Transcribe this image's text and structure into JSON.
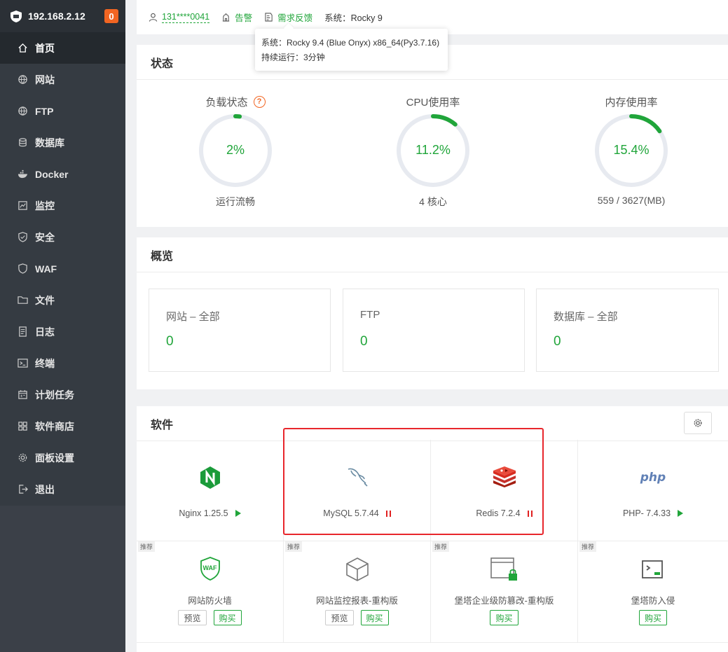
{
  "sidebar": {
    "ip": "192.168.2.12",
    "badge": "0",
    "items": [
      {
        "label": "首页",
        "icon": "home-icon"
      },
      {
        "label": "网站",
        "icon": "globe-icon"
      },
      {
        "label": "FTP",
        "icon": "globe-icon"
      },
      {
        "label": "数据库",
        "icon": "database-icon"
      },
      {
        "label": "Docker",
        "icon": "docker-icon"
      },
      {
        "label": "监控",
        "icon": "monitor-icon"
      },
      {
        "label": "安全",
        "icon": "shield-icon"
      },
      {
        "label": "WAF",
        "icon": "waf-icon"
      },
      {
        "label": "文件",
        "icon": "folder-icon"
      },
      {
        "label": "日志",
        "icon": "log-icon"
      },
      {
        "label": "终端",
        "icon": "terminal-icon"
      },
      {
        "label": "计划任务",
        "icon": "calendar-icon"
      },
      {
        "label": "软件商店",
        "icon": "store-icon"
      },
      {
        "label": "面板设置",
        "icon": "gear-icon"
      },
      {
        "label": "退出",
        "icon": "logout-icon"
      }
    ]
  },
  "topbar": {
    "user": "131****0041",
    "alert": "告警",
    "feedback": "需求反馈",
    "system": "系统：Rocky 9"
  },
  "tooltip": {
    "line1": "系统：Rocky 9.4 (Blue Onyx) x86_64(Py3.7.16)",
    "line2": "持续运行：3分钟"
  },
  "status": {
    "title": "状态",
    "gauges": [
      {
        "label": "负载状态",
        "value": "2%",
        "percent": 2,
        "sub": "运行流畅"
      },
      {
        "label": "CPU使用率",
        "value": "11.2%",
        "percent": 11.2,
        "sub": "4 核心"
      },
      {
        "label": "内存使用率",
        "value": "15.4%",
        "percent": 15.4,
        "sub": "559 / 3627(MB)"
      }
    ],
    "help_icon": "?"
  },
  "overview": {
    "title": "概览",
    "cards": [
      {
        "title": "网站 – 全部",
        "value": "0"
      },
      {
        "title": "FTP",
        "value": "0"
      },
      {
        "title": "数据库 – 全部",
        "value": "0"
      }
    ]
  },
  "software": {
    "title": "软件",
    "installed": [
      {
        "name": "Nginx 1.25.5",
        "state": "play"
      },
      {
        "name": "MySQL 5.7.44",
        "state": "pause"
      },
      {
        "name": "Redis 7.2.4",
        "state": "pause"
      },
      {
        "name": "PHP- 7.4.33",
        "state": "play"
      }
    ],
    "recommended": [
      {
        "tag": "推荐",
        "name": "网站防火墙",
        "preview": "预览",
        "buy": "购买"
      },
      {
        "tag": "推荐",
        "name": "网站监控报表-重构版",
        "preview": "预览",
        "buy": "购买"
      },
      {
        "tag": "推荐",
        "name": "堡塔企业级防篡改-重构版",
        "buy": "购买"
      },
      {
        "tag": "推荐",
        "name": "堡塔防入侵",
        "buy": "购买"
      }
    ],
    "php_logo": "php",
    "waf_logo": "WAF"
  },
  "colors": {
    "accent": "#20a53a",
    "sidebar": "#353b42",
    "badge": "#f26522",
    "highlight": "#e8262c"
  }
}
